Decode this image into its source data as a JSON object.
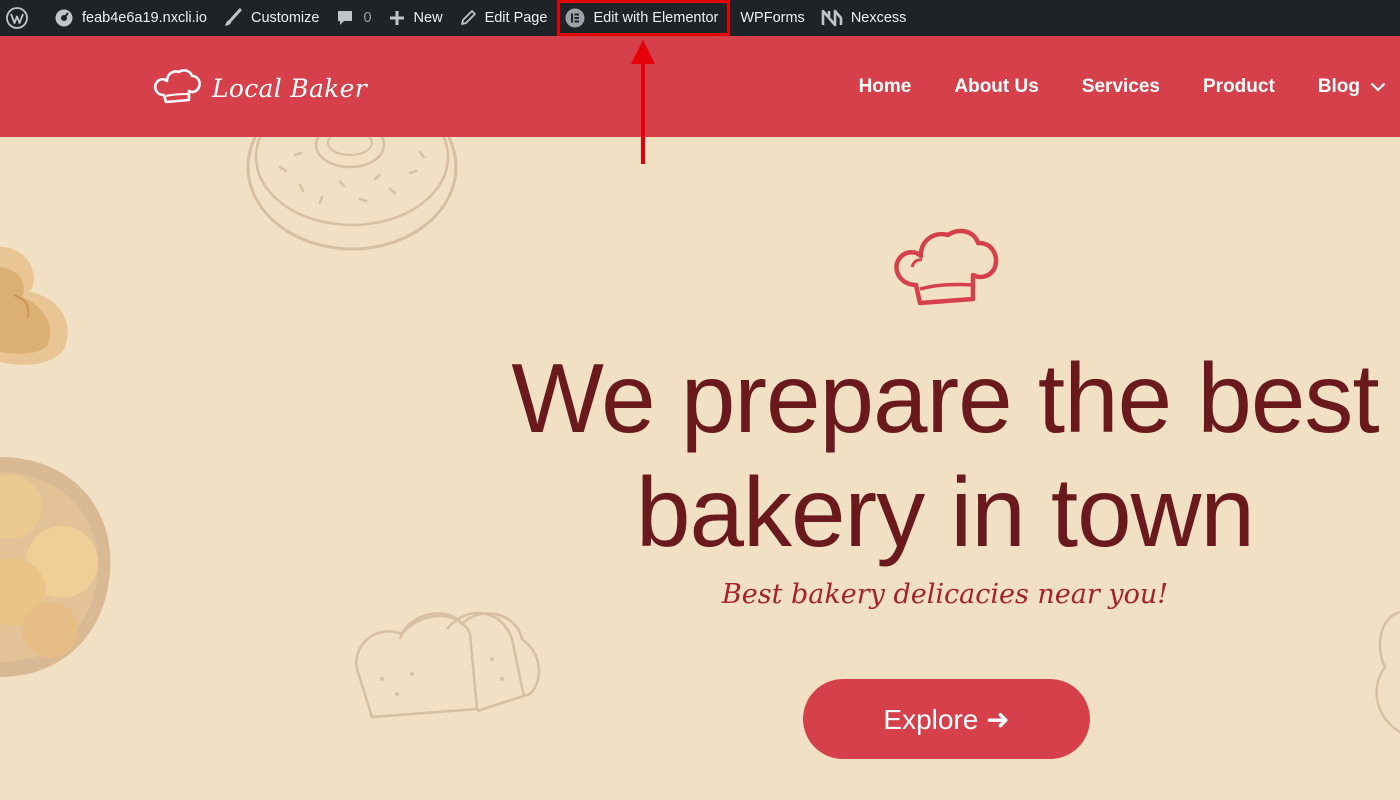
{
  "adminbar": {
    "site": "feab4e6a19.nxcli.io",
    "customize": "Customize",
    "comments_count": "0",
    "new": "New",
    "edit_page": "Edit Page",
    "edit_elementor": "Edit with Elementor",
    "wpforms": "WPForms",
    "nexcess": "Nexcess"
  },
  "header": {
    "logo_text": "Local Baker",
    "nav": [
      "Home",
      "About Us",
      "Services",
      "Product",
      "Blog"
    ]
  },
  "hero": {
    "title_line1": "We prepare the best",
    "title_line2": "bakery in town",
    "subtitle": "Best bakery delicacies near you!",
    "button": "Explore ➜"
  },
  "colors": {
    "adminbar_bg": "#1d2327",
    "header_bg": "#d6404a",
    "hero_bg": "#f2e0c4",
    "title": "#6a1a1d",
    "subtitle": "#a8202a",
    "highlight": "#e5000a"
  }
}
